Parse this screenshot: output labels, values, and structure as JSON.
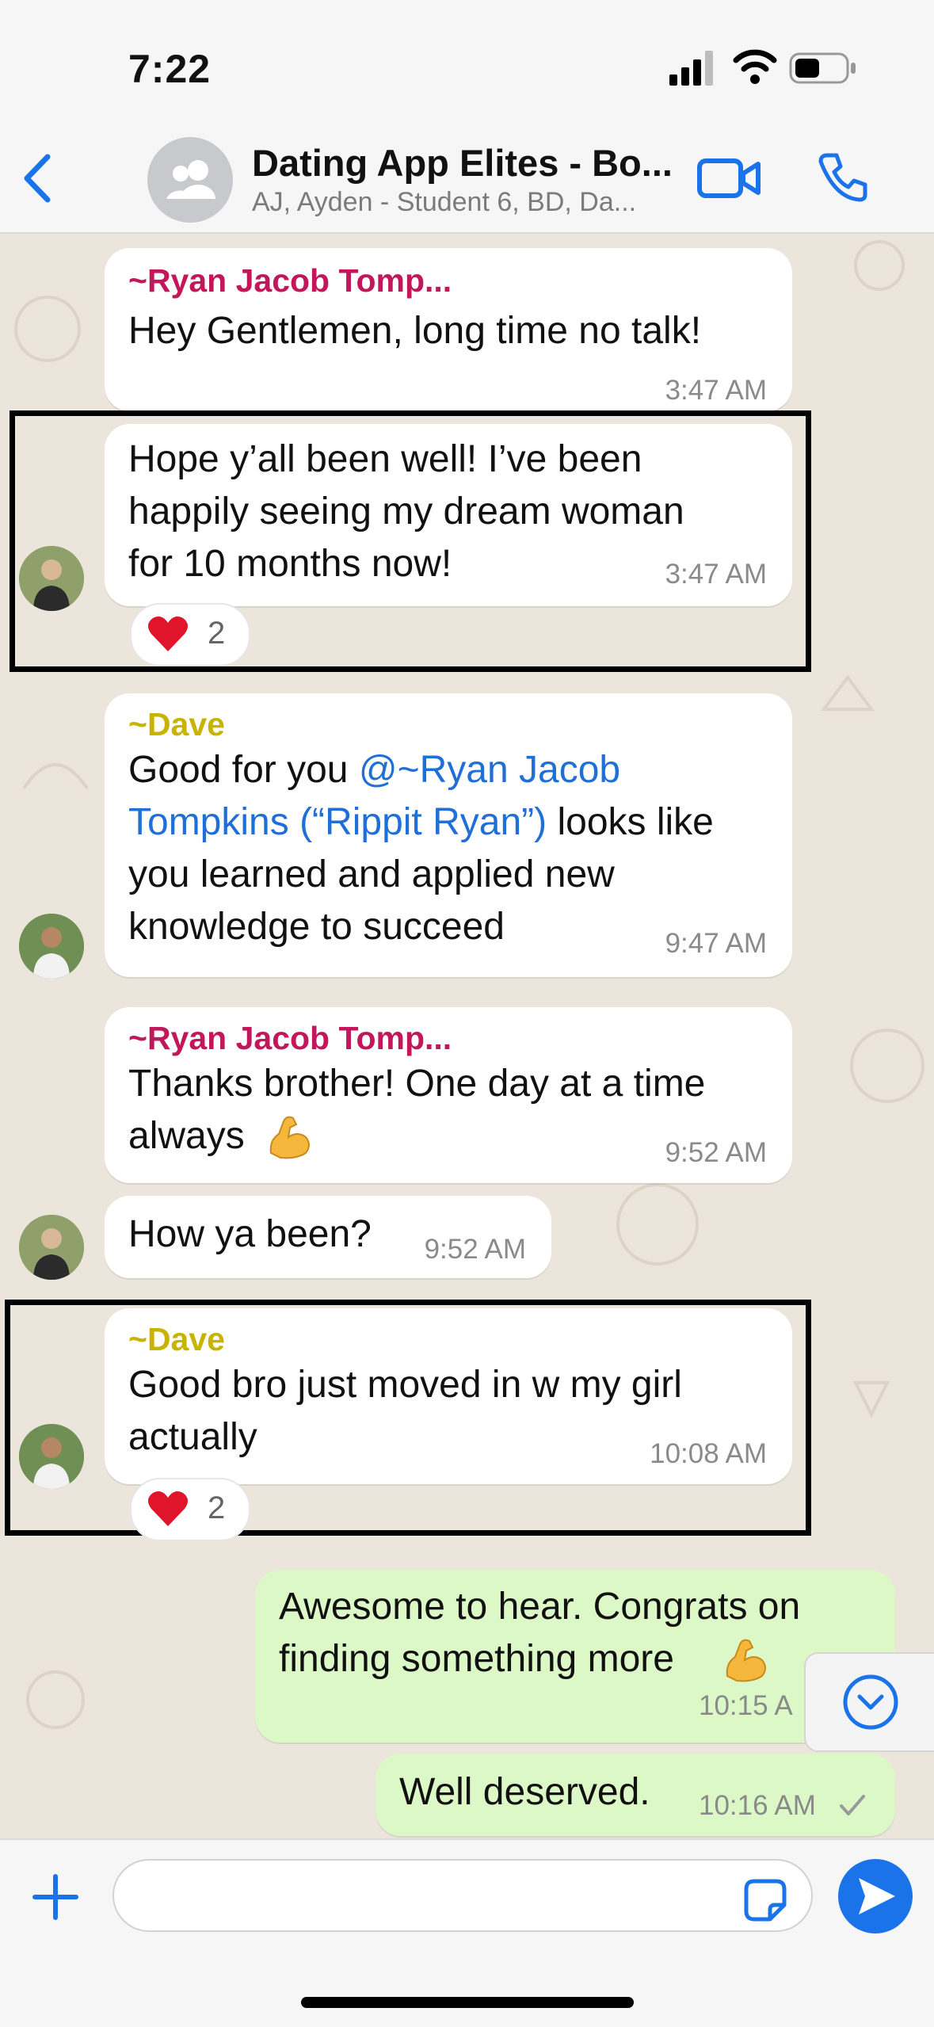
{
  "status": {
    "time": "7:22"
  },
  "header": {
    "title": "Dating App Elites - Bo...",
    "subtitle": "AJ, Ayden - Student 6, BD, Da..."
  },
  "colors": {
    "ryan": "#c2185b",
    "dave": "#c8b400",
    "link": "#1f6fd6",
    "accent": "#1a73e8"
  },
  "messages": [
    {
      "sender": "~Ryan Jacob Tomp...",
      "lines": [
        "Hey Gentlemen, long time no talk!"
      ],
      "time": "3:47 AM"
    },
    {
      "lines": [
        "Hope y’all been well! I’ve been",
        "happily seeing my dream woman",
        "for 10 months now!"
      ],
      "time": "3:47 AM",
      "reaction": {
        "emoji": "heart",
        "count": "2"
      }
    },
    {
      "sender": "~Dave",
      "line1_pre": "Good for you ",
      "line1_mention": "@~Ryan Jacob",
      "line2_mention": "Tompkins (“Rippit Ryan”)",
      "line2_post": " looks like",
      "line3": "you learned and applied new",
      "line4": "knowledge to succeed",
      "time": "9:47 AM"
    },
    {
      "sender": "~Ryan Jacob Tomp...",
      "lines": [
        "Thanks brother! One day at a time",
        "always"
      ],
      "time": "9:52 AM",
      "emoji": "flexed-biceps"
    },
    {
      "lines": [
        "How ya been?"
      ],
      "time": "9:52 AM"
    },
    {
      "sender": "~Dave",
      "lines": [
        "Good bro just moved in w my girl",
        "actually"
      ],
      "time": "10:08 AM",
      "reaction": {
        "emoji": "heart",
        "count": "2"
      }
    },
    {
      "outgoing": true,
      "lines": [
        "Awesome to hear. Congrats on",
        "finding something more"
      ],
      "time": "10:15 A",
      "emoji": "flexed-biceps"
    },
    {
      "outgoing": true,
      "lines": [
        "Well deserved."
      ],
      "time": "10:16 AM",
      "status": "sent-check"
    }
  ]
}
